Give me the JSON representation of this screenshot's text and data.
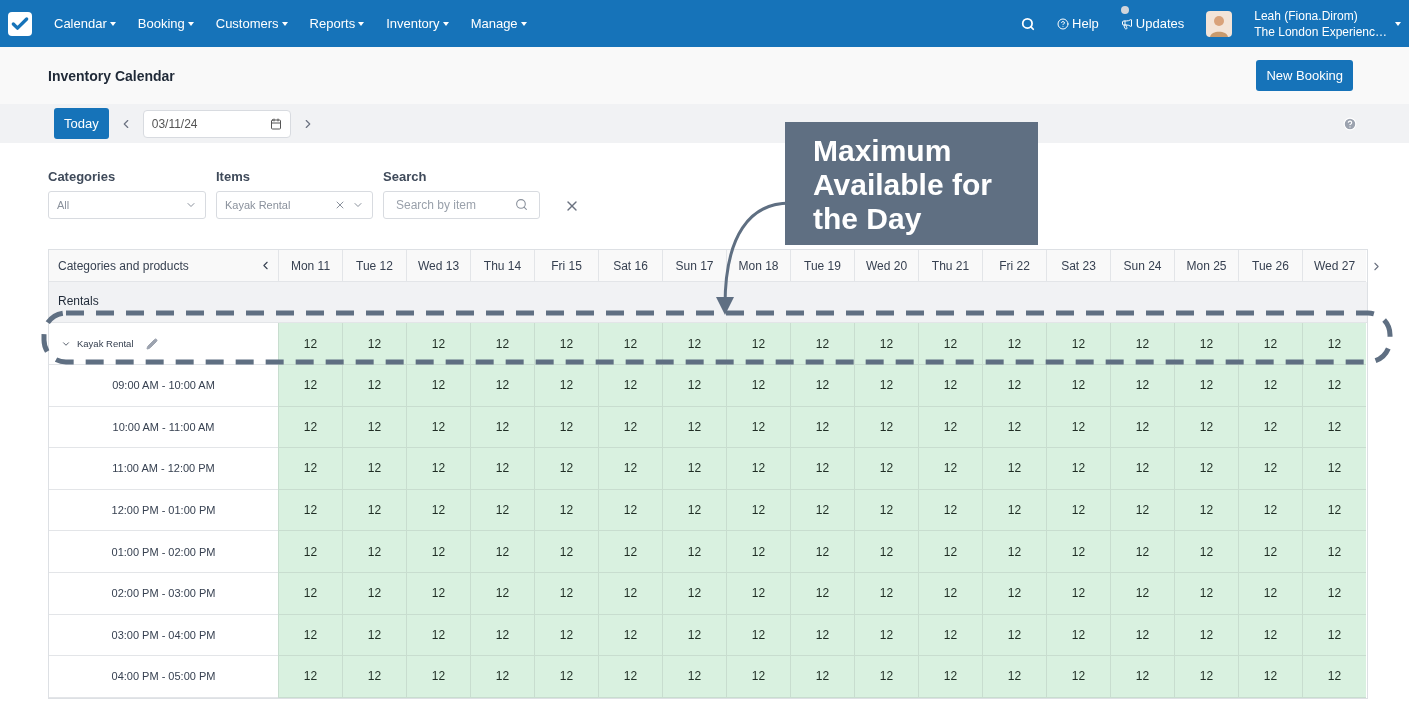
{
  "nav": {
    "menus": [
      "Calendar",
      "Booking",
      "Customers",
      "Reports",
      "Inventory",
      "Manage"
    ],
    "help": "Help",
    "updates": "Updates",
    "user_name": "Leah (Fiona.Dirom)",
    "user_org": "The London Experienc…"
  },
  "page": {
    "title": "Inventory Calendar",
    "new_booking": "New Booking"
  },
  "toolbar": {
    "today": "Today",
    "date": "03/11/24"
  },
  "filters": {
    "categories": {
      "label": "Categories",
      "value": "All"
    },
    "items": {
      "label": "Items",
      "value": "Kayak Rental"
    },
    "search": {
      "label": "Search",
      "placeholder": "Search by item"
    }
  },
  "table": {
    "header_label": "Categories and products",
    "days": [
      "Mon 11",
      "Tue 12",
      "Wed 13",
      "Thu 14",
      "Fri 15",
      "Sat 16",
      "Sun 17",
      "Mon 18",
      "Tue 19",
      "Wed 20",
      "Thu 21",
      "Fri 22",
      "Sat 23",
      "Sun 24",
      "Mon 25",
      "Tue 26",
      "Wed 27"
    ],
    "groups": [
      {
        "name": "Rentals",
        "items": [
          {
            "name": "Kayak Rental",
            "expanded": true,
            "values": [
              "12",
              "12",
              "12",
              "12",
              "12",
              "12",
              "12",
              "12",
              "12",
              "12",
              "12",
              "12",
              "12",
              "12",
              "12",
              "12",
              "12"
            ],
            "slots": [
              {
                "time": "09:00 AM - 10:00 AM",
                "values": [
                  "12",
                  "12",
                  "12",
                  "12",
                  "12",
                  "12",
                  "12",
                  "12",
                  "12",
                  "12",
                  "12",
                  "12",
                  "12",
                  "12",
                  "12",
                  "12",
                  "12"
                ]
              },
              {
                "time": "10:00 AM - 11:00 AM",
                "values": [
                  "12",
                  "12",
                  "12",
                  "12",
                  "12",
                  "12",
                  "12",
                  "12",
                  "12",
                  "12",
                  "12",
                  "12",
                  "12",
                  "12",
                  "12",
                  "12",
                  "12"
                ]
              },
              {
                "time": "11:00 AM - 12:00 PM",
                "values": [
                  "12",
                  "12",
                  "12",
                  "12",
                  "12",
                  "12",
                  "12",
                  "12",
                  "12",
                  "12",
                  "12",
                  "12",
                  "12",
                  "12",
                  "12",
                  "12",
                  "12"
                ]
              },
              {
                "time": "12:00 PM - 01:00 PM",
                "values": [
                  "12",
                  "12",
                  "12",
                  "12",
                  "12",
                  "12",
                  "12",
                  "12",
                  "12",
                  "12",
                  "12",
                  "12",
                  "12",
                  "12",
                  "12",
                  "12",
                  "12"
                ]
              },
              {
                "time": "01:00 PM - 02:00 PM",
                "values": [
                  "12",
                  "12",
                  "12",
                  "12",
                  "12",
                  "12",
                  "12",
                  "12",
                  "12",
                  "12",
                  "12",
                  "12",
                  "12",
                  "12",
                  "12",
                  "12",
                  "12"
                ]
              },
              {
                "time": "02:00 PM - 03:00 PM",
                "values": [
                  "12",
                  "12",
                  "12",
                  "12",
                  "12",
                  "12",
                  "12",
                  "12",
                  "12",
                  "12",
                  "12",
                  "12",
                  "12",
                  "12",
                  "12",
                  "12",
                  "12"
                ]
              },
              {
                "time": "03:00 PM - 04:00 PM",
                "values": [
                  "12",
                  "12",
                  "12",
                  "12",
                  "12",
                  "12",
                  "12",
                  "12",
                  "12",
                  "12",
                  "12",
                  "12",
                  "12",
                  "12",
                  "12",
                  "12",
                  "12"
                ]
              },
              {
                "time": "04:00 PM - 05:00 PM",
                "values": [
                  "12",
                  "12",
                  "12",
                  "12",
                  "12",
                  "12",
                  "12",
                  "12",
                  "12",
                  "12",
                  "12",
                  "12",
                  "12",
                  "12",
                  "12",
                  "12",
                  "12"
                ]
              }
            ]
          }
        ]
      }
    ]
  },
  "annotation": {
    "text": "Maximum Available for the Day"
  }
}
